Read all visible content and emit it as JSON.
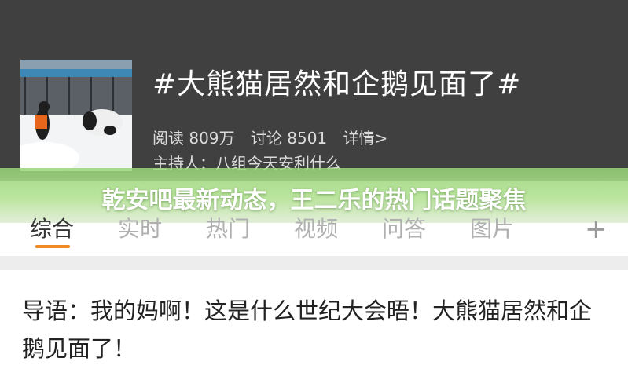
{
  "topic": {
    "title": "#大熊猫居然和企鹅见面了#",
    "reads": "阅读 809万",
    "discussions": "讨论 8501",
    "details_link": "详情>",
    "host": "主持人：八组今天安利什么"
  },
  "banner": {
    "text": "乾安吧最新动态，王二乐的热门话题聚焦"
  },
  "tabs": [
    {
      "label": "综合",
      "active": true
    },
    {
      "label": "实时",
      "active": false
    },
    {
      "label": "热门",
      "active": false
    },
    {
      "label": "视频",
      "active": false
    },
    {
      "label": "问答",
      "active": false
    },
    {
      "label": "图片",
      "active": false
    }
  ],
  "add_tab_label": "+",
  "lead": {
    "text": "导语：我的妈啊！这是什么世纪大会晤！大熊猫居然和企鹅见面了！"
  },
  "colors": {
    "header_bg": "#404040",
    "accent": "#f08a24",
    "banner": "#a9dd8c"
  }
}
